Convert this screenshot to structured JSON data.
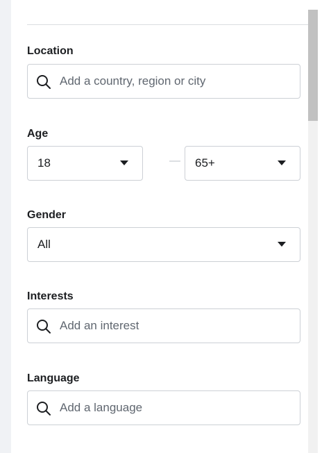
{
  "location": {
    "label": "Location",
    "placeholder": "Add a country, region or city",
    "value": ""
  },
  "age": {
    "label": "Age",
    "min_value": "18",
    "separator": "—",
    "max_value": "65+"
  },
  "gender": {
    "label": "Gender",
    "value": "All"
  },
  "interests": {
    "label": "Interests",
    "placeholder": "Add an interest",
    "value": ""
  },
  "language": {
    "label": "Language",
    "placeholder": "Add a language",
    "value": ""
  },
  "icons": {
    "search": "search-icon",
    "dropdown": "caret-down-icon"
  },
  "colors": {
    "text": "#1c1e21",
    "placeholder": "#606770",
    "border": "#ccd0d5",
    "background_side": "#f0f2f5"
  },
  "scrollbar": {
    "position_fraction": 0.0
  }
}
